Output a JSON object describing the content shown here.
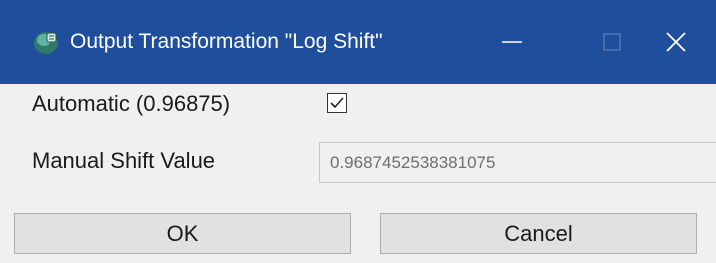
{
  "window": {
    "title": "Output Transformation \"Log Shift\"",
    "app_icon": "app-icon",
    "minimize_icon": "minimize-icon",
    "maximize_icon": "maximize-icon",
    "close_icon": "close-icon"
  },
  "form": {
    "automatic_label": "Automatic (0.96875)",
    "automatic_checked": true,
    "manual_label": "Manual Shift Value",
    "manual_value": "0.9687452538381075",
    "manual_enabled": false
  },
  "buttons": {
    "ok_label": "OK",
    "cancel_label": "Cancel"
  },
  "colors": {
    "titlebar": "#1f4f9c",
    "background": "#f0f0f0",
    "button": "#e1e1e1",
    "disabled_text": "#6e6e6e"
  }
}
